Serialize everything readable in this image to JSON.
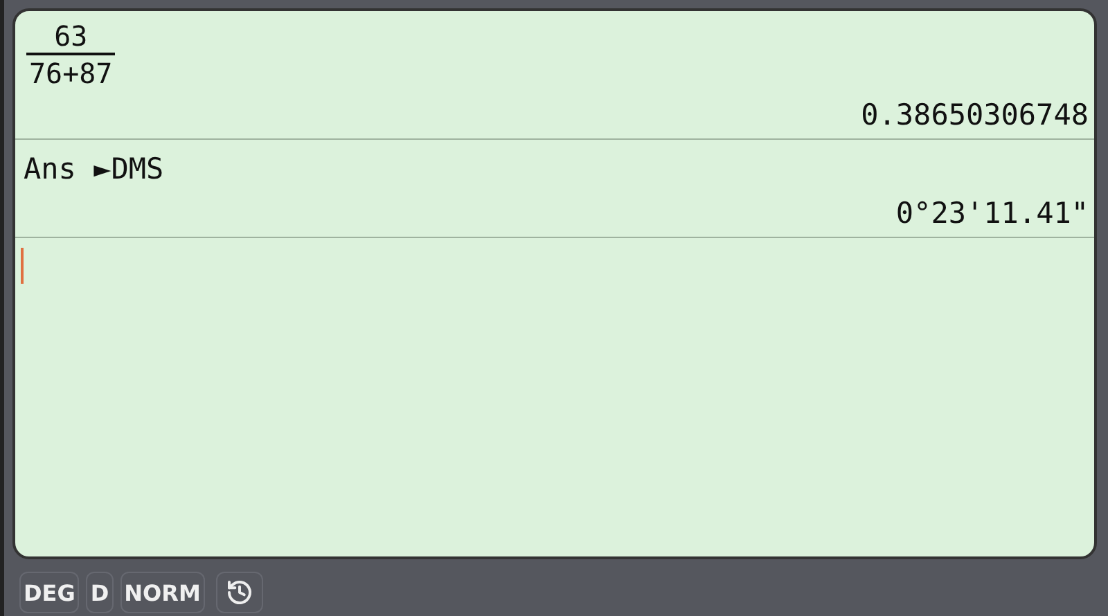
{
  "history": [
    {
      "input": {
        "kind": "fraction",
        "numerator": "63",
        "denominator": "76+87"
      },
      "result": "0.38650306748"
    },
    {
      "input": {
        "kind": "text",
        "text": "Ans ►DMS"
      },
      "result": "0°23'11.41\""
    }
  ],
  "status_bar": {
    "indicators": [
      "DEG",
      "D",
      "NORM"
    ]
  }
}
